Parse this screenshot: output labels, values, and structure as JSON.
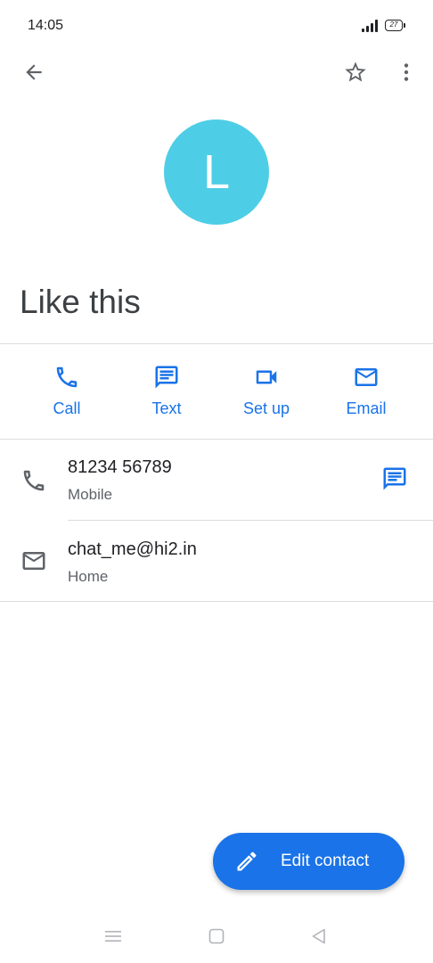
{
  "status_bar": {
    "time": "14:05",
    "battery": "27"
  },
  "contact": {
    "avatar_letter": "L",
    "name": "Like this"
  },
  "actions": [
    {
      "label": "Call",
      "icon": "phone-icon"
    },
    {
      "label": "Text",
      "icon": "message-icon"
    },
    {
      "label": "Set up",
      "icon": "video-icon"
    },
    {
      "label": "Email",
      "icon": "email-icon"
    }
  ],
  "details": {
    "phone": {
      "number": "81234 56789",
      "type": "Mobile"
    },
    "email": {
      "address": "chat_me@hi2.in",
      "type": "Home"
    }
  },
  "fab": {
    "label": "Edit contact",
    "icon": "pencil-icon"
  },
  "colors": {
    "accent": "#1a73e8",
    "avatar": "#4ecde6"
  }
}
